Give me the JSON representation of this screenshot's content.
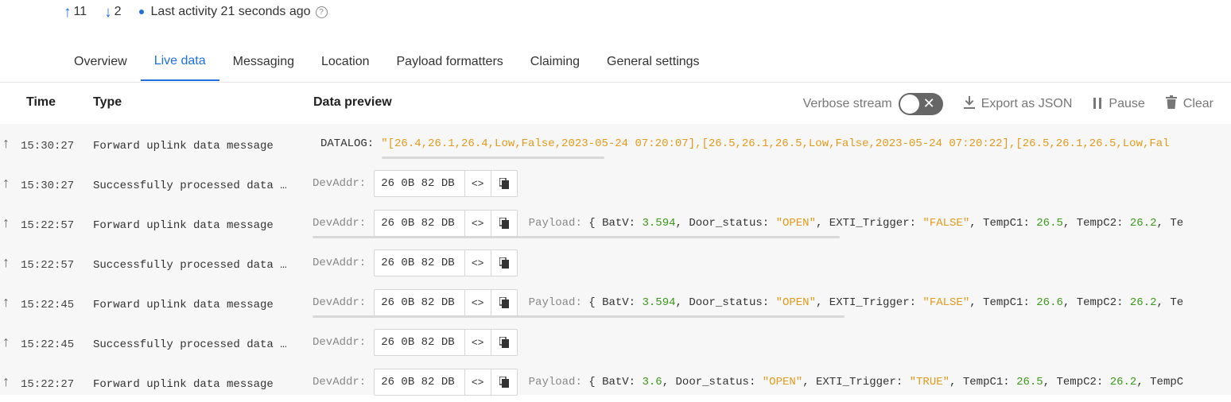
{
  "status": {
    "up_count": "11",
    "down_count": "2",
    "last_activity": "Last activity 21 seconds ago"
  },
  "tabs": [
    {
      "label": "Overview"
    },
    {
      "label": "Live data"
    },
    {
      "label": "Messaging"
    },
    {
      "label": "Location"
    },
    {
      "label": "Payload formatters"
    },
    {
      "label": "Claiming"
    },
    {
      "label": "General settings"
    }
  ],
  "table": {
    "col_time": "Time",
    "col_type": "Type",
    "col_preview": "Data preview",
    "verbose_stream": "Verbose stream",
    "export_json": "Export as JSON",
    "pause": "Pause",
    "clear": "Clear"
  },
  "icons": {
    "up": "arrow-up-icon",
    "down": "arrow-down-icon",
    "code": "code-icon",
    "copy": "copy-icon",
    "download": "download-icon",
    "pause": "pause-icon",
    "trash": "trash-icon"
  },
  "rows": [
    {
      "time": "15:30:27",
      "type": "Forward uplink data message",
      "datalog_label": "DATALOG:",
      "datalog_value": "\"[26.4,26.1,26.4,Low,False,2023-05-24 07:20:07],[26.5,26.1,26.5,Low,False,2023-05-24 07:20:22],[26.5,26.1,26.5,Low,Fal"
    },
    {
      "time": "15:30:27",
      "type": "Successfully processed data …",
      "devaddr_label": "DevAddr:",
      "devaddr": "26 0B 82 DB"
    },
    {
      "time": "15:22:57",
      "type": "Forward uplink data message",
      "devaddr_label": "DevAddr:",
      "devaddr": "26 0B 82 DB",
      "payload_label": "Payload:",
      "batv": "3.594",
      "door": "\"OPEN\"",
      "exti": "\"FALSE\"",
      "tempc1": "26.5",
      "tempc2": "26.2",
      "tail": "Te"
    },
    {
      "time": "15:22:57",
      "type": "Successfully processed data …",
      "devaddr_label": "DevAddr:",
      "devaddr": "26 0B 82 DB"
    },
    {
      "time": "15:22:45",
      "type": "Forward uplink data message",
      "devaddr_label": "DevAddr:",
      "devaddr": "26 0B 82 DB",
      "payload_label": "Payload:",
      "batv": "3.594",
      "door": "\"OPEN\"",
      "exti": "\"FALSE\"",
      "tempc1": "26.6",
      "tempc2": "26.2",
      "tail": "Te"
    },
    {
      "time": "15:22:45",
      "type": "Successfully processed data …",
      "devaddr_label": "DevAddr:",
      "devaddr": "26 0B 82 DB"
    },
    {
      "time": "15:22:27",
      "type": "Forward uplink data message",
      "devaddr_label": "DevAddr:",
      "devaddr": "26 0B 82 DB",
      "payload_label": "Payload:",
      "batv": "3.6",
      "door": "\"OPEN\"",
      "exti": "\"TRUE\"",
      "tempc1": "26.5",
      "tempc2": "26.2",
      "tail": "TempC"
    }
  ],
  "payload_keys": {
    "open": "{",
    "batv": "BatV:",
    "door": "Door_status:",
    "exti": "EXTI_Trigger:",
    "tempc1": "TempC1:",
    "tempc2": "TempC2:",
    "comma": ","
  },
  "colors": {
    "accent": "#1f6fe0",
    "number": "#3a9a1a",
    "string": "#e39a1a"
  }
}
